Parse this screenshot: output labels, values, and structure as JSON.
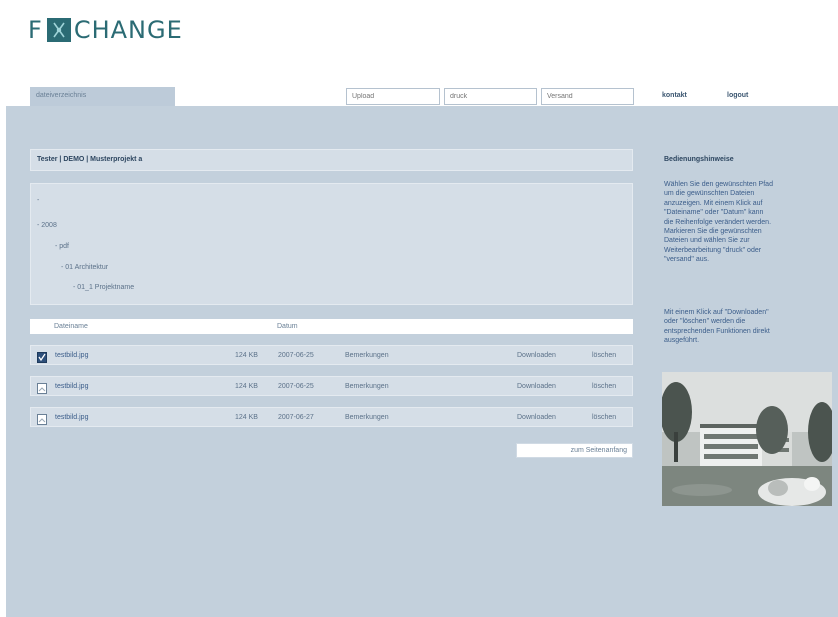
{
  "logo": {
    "left": "F",
    "word": "CHANGE"
  },
  "tabs": {
    "active": "dateiverzeichnis"
  },
  "search": {
    "upload_placeholder": "Upload",
    "druck_placeholder": "druck",
    "versand_placeholder": "Versand"
  },
  "top_links": {
    "kontakt": "kontakt",
    "logout": "logout"
  },
  "breadcrumb": "Tester | DEMO | Musterprojekt a",
  "tree": [
    "-",
    "- 2008",
    "- pdf",
    "- 01 Architektur",
    "- 01_1 Projektname"
  ],
  "table": {
    "headers": {
      "name": "Dateiname",
      "date": "Datum"
    },
    "rows": [
      {
        "name": "testbild.jpg",
        "size": "124 KB",
        "date": "2007-06-25",
        "comment": "Bemerkungen",
        "download": "Downloaden",
        "delete": "löschen",
        "checked": true
      },
      {
        "name": "testbild.jpg",
        "size": "124 KB",
        "date": "2007-06-25",
        "comment": "Bemerkungen",
        "download": "Downloaden",
        "delete": "löschen",
        "checked": false
      },
      {
        "name": "testbild.jpg",
        "size": "124 KB",
        "date": "2007-06-27",
        "comment": "Bemerkungen",
        "download": "Downloaden",
        "delete": "löschen",
        "checked": false
      }
    ]
  },
  "sort_button": "zum Seitenanfang",
  "sidebar": {
    "heading": "Bedienungshinweise",
    "para1": [
      "Wählen Sie den gewünschten Pfad",
      "um die gewünschten Dateien",
      "anzuzeigen. Mit einem Klick auf",
      "\"Dateiname\" oder \"Datum\" kann",
      "die Reihenfolge verändert werden.",
      "Markieren Sie die gewünschten",
      "Dateien und wählen Sie zur",
      "Weiterbearbeitung \"druck\" oder",
      "\"versand\" aus."
    ],
    "para2": [
      "Mit einem Klick auf \"Downloaden\"",
      "oder \"löschen\" werden die",
      "entsprechenden Funktionen direkt",
      "ausgeführt."
    ]
  },
  "colors": {
    "brand": "#2b6b74",
    "panel": "#c3d0dc",
    "box": "#d5dee7",
    "text": "#2d4660"
  }
}
